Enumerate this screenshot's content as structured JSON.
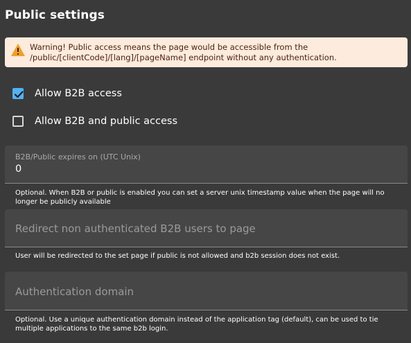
{
  "header": {
    "title": "Public settings"
  },
  "warning": {
    "icon": "warning-triangle-icon",
    "icon_color": "#f0a020",
    "background": "#fdebde",
    "text": "Warning! Public access means the page would be accessible from the /public/[clientCode]/[lang]/[pageName] endpoint without any authentication."
  },
  "options": {
    "allow_b2b": {
      "label": "Allow B2B access",
      "checked": true
    },
    "allow_public": {
      "label": "Allow B2B and public access",
      "checked": false
    }
  },
  "fields": {
    "expires": {
      "label": "B2B/Public expires on (UTC Unix)",
      "value": "0",
      "helper": "Optional. When B2B or public is enabled you can set a server unix timestamp value when the page will no longer be publicly available"
    },
    "redirect": {
      "placeholder": "Redirect non authenticated B2B users to page",
      "value": "",
      "helper": "User will be redirected to the set page if public is not allowed and b2b session does not exist."
    },
    "auth_domain": {
      "placeholder": "Authentication domain",
      "value": "",
      "helper": "Optional. Use a unique authentication domain instead of the application tag (default), can be used to tie multiple applications to the same b2b login."
    }
  },
  "colors": {
    "background": "#3a3a3a",
    "field_background": "#464646",
    "checkbox_accent": "#4fb3f6"
  }
}
